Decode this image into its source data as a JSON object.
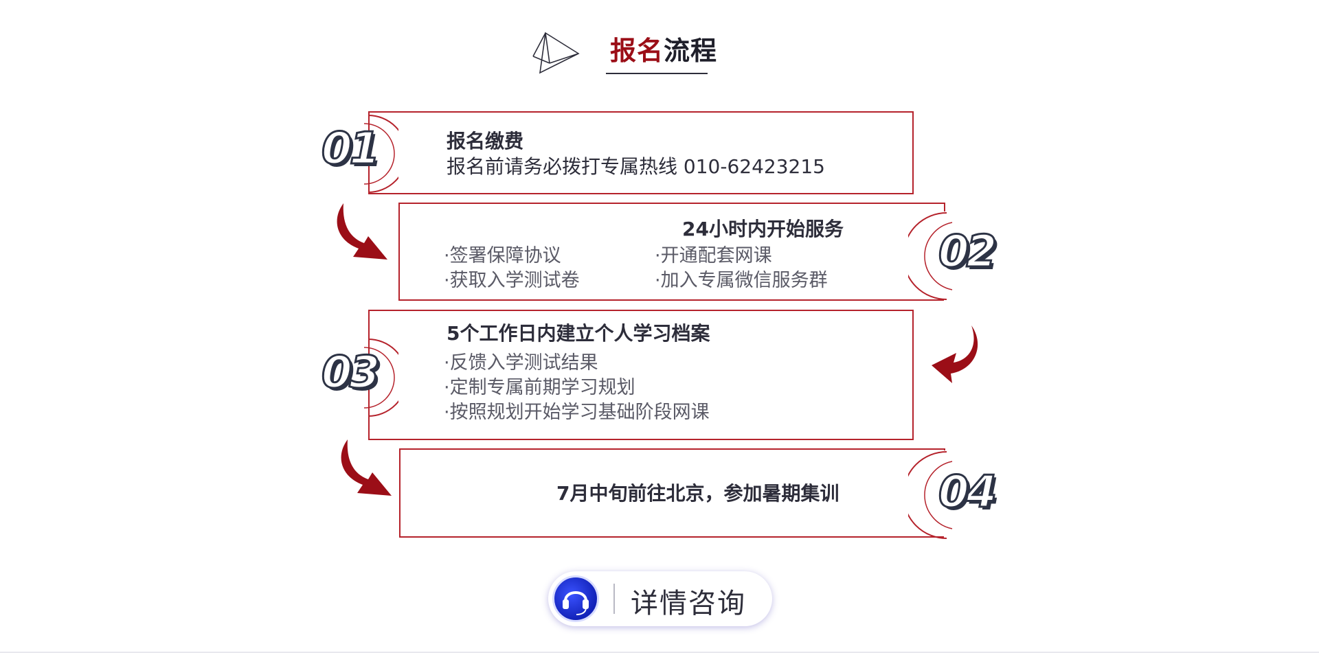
{
  "header": {
    "title_part1": "报名",
    "title_part2": "流程"
  },
  "steps": [
    {
      "number": "01",
      "title": "报名缴费",
      "line": "报名前请务必拨打专属热线 010-62423215"
    },
    {
      "number": "02",
      "title": "24小时内开始服务",
      "bullets_left": [
        "·签署保障协议",
        "·获取入学测试卷"
      ],
      "bullets_right": [
        "·开通配套网课",
        "·加入专属微信服务群"
      ]
    },
    {
      "number": "03",
      "title": "5个工作日内建立个人学习档案",
      "bullets": [
        "·反馈入学测试结果",
        "·定制专属前期学习规划",
        "·按照规划开始学习基础阶段网课"
      ]
    },
    {
      "number": "04",
      "title": "7月中旬前往北京，参加暑期集训"
    }
  ],
  "consult_button": {
    "label": "详情咨询",
    "icon": "headset-icon"
  },
  "colors": {
    "accent": "#9b0e17",
    "border": "#b5222b",
    "text": "#2d2d3a",
    "bullet": "#5a5a66"
  }
}
